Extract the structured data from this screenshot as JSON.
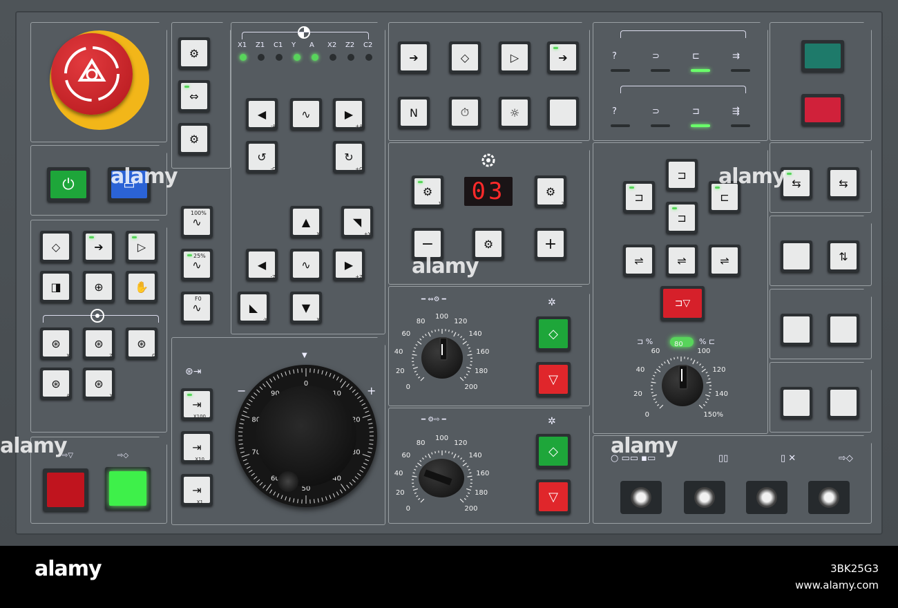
{
  "axes": [
    "X1",
    "Z1",
    "C1",
    "Y",
    "A",
    "X2",
    "Z2",
    "C2"
  ],
  "axes_led_state": [
    "on",
    "off",
    "off",
    "on",
    "on",
    "off",
    "off",
    "off"
  ],
  "display": {
    "value": "03"
  },
  "labels": {
    "minus_a": "-A",
    "plus_a": "+A",
    "minus_c": "-C",
    "plus_c": "+C",
    "x": "X",
    "plus_y": "+Y",
    "minus_z": "-Z",
    "plus_z": "+Z",
    "minus_y": "-Y",
    "x2": "X",
    "rapid_100": "100%",
    "rapid_25": "25%",
    "rapid_f0": "F0",
    "x100": "X100",
    "x10": "X10",
    "x1": "X1",
    "spindle_1": "1",
    "spindle_2": "2",
    "wheel_x": "X",
    "wheel_z": "Z",
    "wheel_c": "C",
    "wheel_a": "A",
    "wheel_y": "Y",
    "override_pct_a": "%",
    "override_pct_b": "%",
    "pct_150": "150%",
    "minus": "−",
    "plus": "+"
  },
  "override_scale": [
    "0",
    "20",
    "40",
    "60",
    "80",
    "100",
    "120",
    "140",
    "160",
    "180",
    "200"
  ],
  "override_units": "%",
  "handwheel_ticks": [
    "0",
    "10",
    "20",
    "30",
    "40",
    "50",
    "60",
    "70",
    "80",
    "90"
  ],
  "right_dial_scale": [
    "0",
    "20",
    "40",
    "60",
    "80",
    "100",
    "120",
    "140",
    "150%"
  ],
  "colors": {
    "panel": "#555b60",
    "led_green": "#58d45b",
    "estop_red": "#c41f24",
    "display_red": "#ff2a2a",
    "start_green": "#1ea63a",
    "stop_red": "#e0262b"
  },
  "footer": {
    "brand": "alamy",
    "image_id": "3BK25G3",
    "site": "www.alamy.com"
  },
  "watermark": "alamy"
}
